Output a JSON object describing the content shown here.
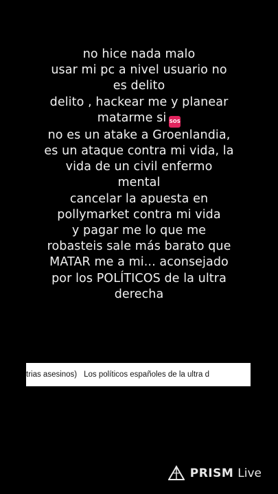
{
  "caption": {
    "lines": [
      "no hice nada malo",
      "usar mi pc a nivel usuario no",
      "es delito",
      "delito , hackear me y planear",
      "matarme si",
      "no es un atake a Groenlandia,",
      "es un ataque contra mi vida, la",
      "vida de un civil enfermo",
      "mental",
      "cancelar la apuesta en",
      "pollymarket contra mi vida",
      "y pagar me lo que me",
      "robasteis sale más barato que",
      "MATAR me a mi... aconsejado",
      "por los POLÍTICOS de la ultra",
      "derecha"
    ],
    "emoji": {
      "name": "sos-emoji",
      "label": "SOS",
      "color": "#e0245e"
    }
  },
  "ticker": {
    "segment_1": "trias asesinos)",
    "segment_2": "Los políticos españoles de la ultra d"
  },
  "watermark": {
    "brand": "PRISM",
    "suffix": "Live",
    "icon": "prism-triangle-icon"
  }
}
